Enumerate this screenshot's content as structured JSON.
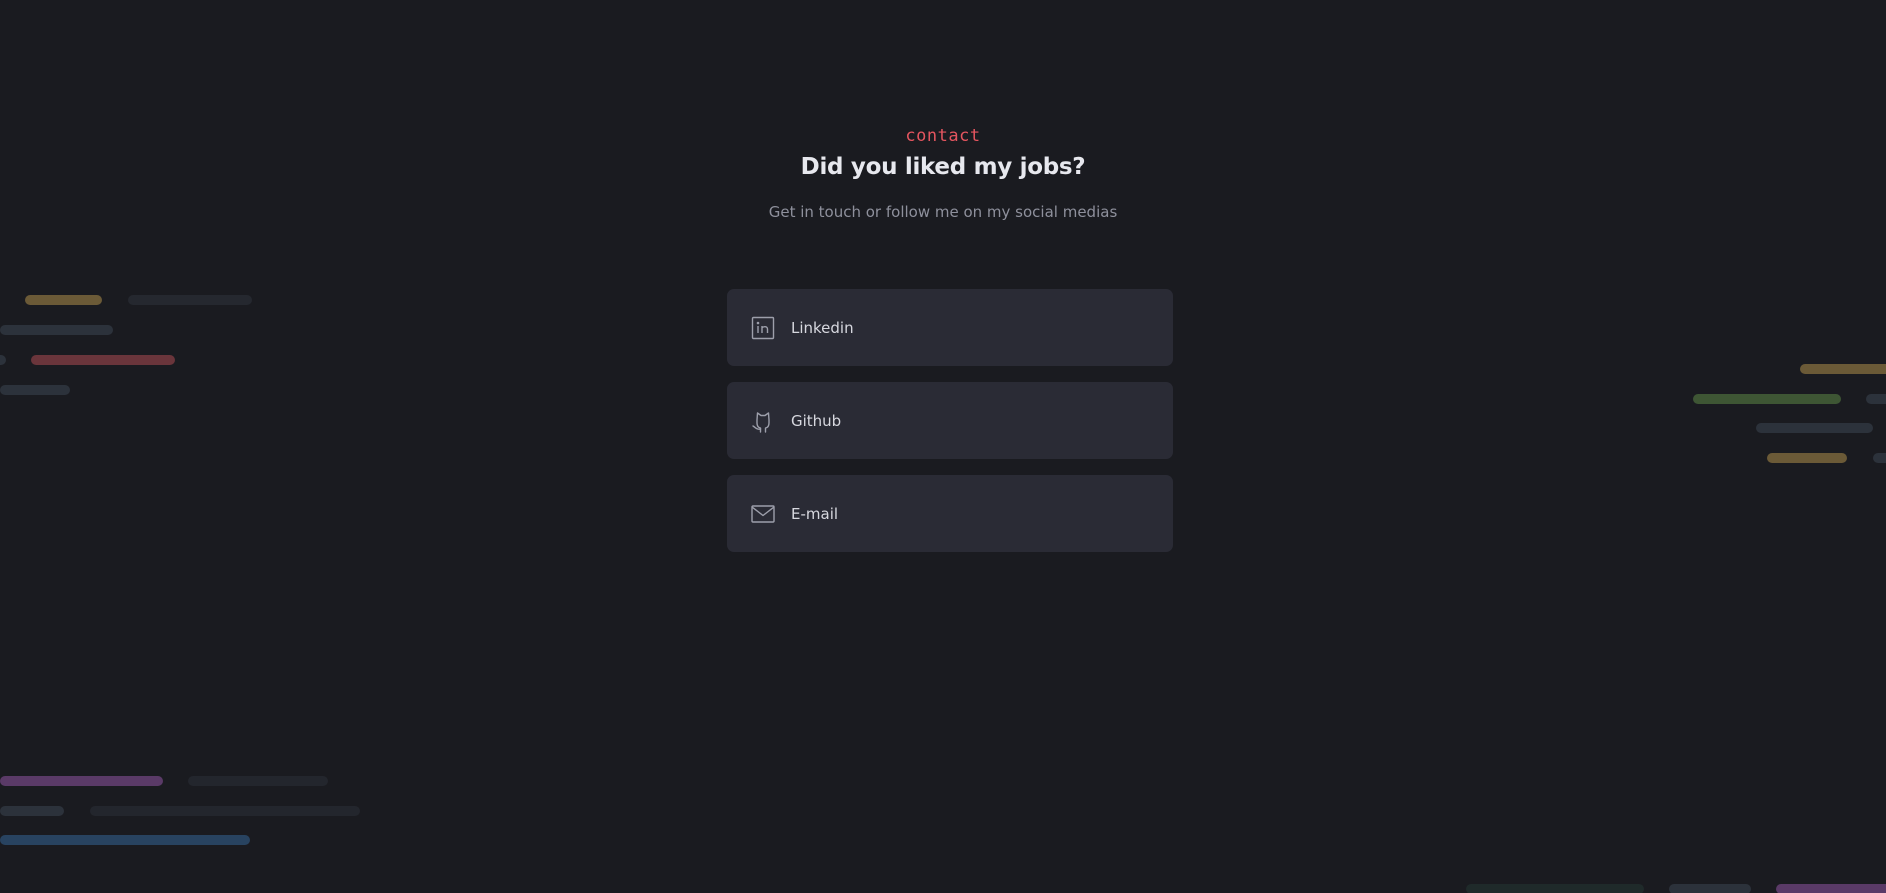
{
  "colors": {
    "background": "#1a1b20",
    "card": "#2a2b35",
    "accent": "#e4555f",
    "icon": "#9d9fab"
  },
  "header": {
    "eyebrow": "contact",
    "title": "Did you liked my jobs?",
    "subtitle": "Get in touch or follow me on my social medias"
  },
  "contacts": [
    {
      "icon": "linkedin-icon",
      "label": "Linkedin"
    },
    {
      "icon": "github-icon",
      "label": "Github"
    },
    {
      "icon": "mail-icon",
      "label": "E-mail"
    }
  ]
}
